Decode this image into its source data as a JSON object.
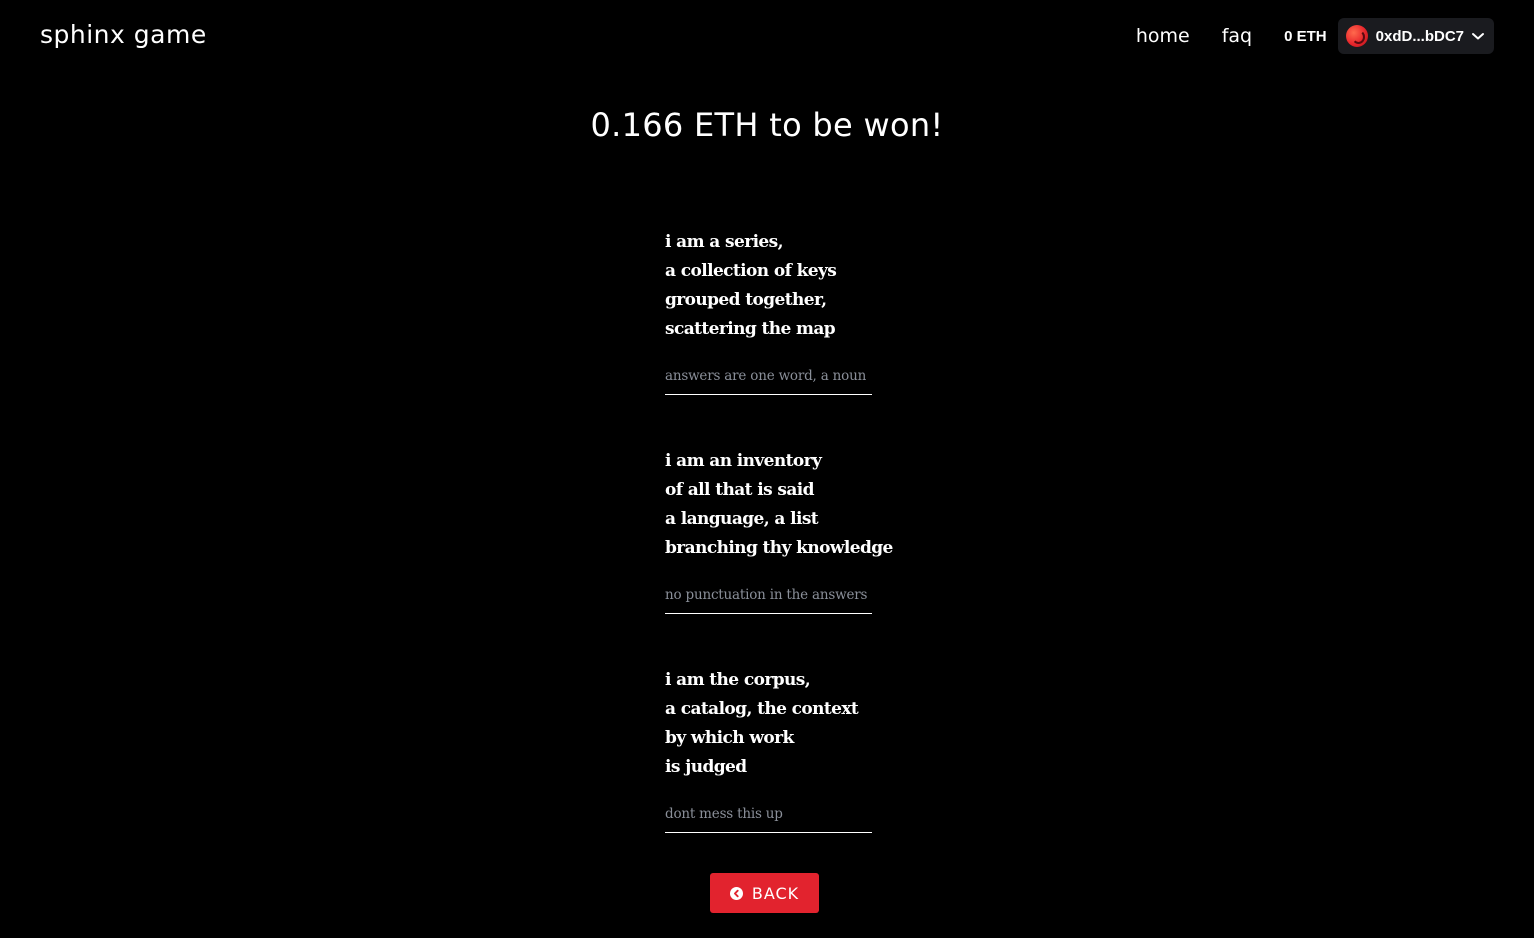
{
  "header": {
    "logo": "sphinx game",
    "nav": {
      "home_label": "home",
      "faq_label": "faq"
    },
    "balance": "0 ETH",
    "account": {
      "address": "0xdD...bDC7",
      "avatar_color": "#e8262c"
    }
  },
  "main": {
    "prize_title": "0.166 ETH to be won!",
    "riddles": [
      {
        "lines": [
          "i am a series,",
          "a collection of keys",
          "grouped together,",
          "scattering the map"
        ],
        "placeholder": "answers are one word, a noun",
        "value": ""
      },
      {
        "lines": [
          "i am an inventory",
          "of all that is said",
          "a language, a list",
          "branching thy knowledge"
        ],
        "placeholder": "no punctuation in the answers",
        "value": ""
      },
      {
        "lines": [
          "i am the corpus,",
          "a catalog, the context",
          "by which work",
          "is judged"
        ],
        "placeholder": "dont mess this up",
        "value": ""
      }
    ],
    "back_button": {
      "label": "BACK",
      "icon": "chevron-left-circle-icon",
      "color": "#e2232e"
    }
  }
}
